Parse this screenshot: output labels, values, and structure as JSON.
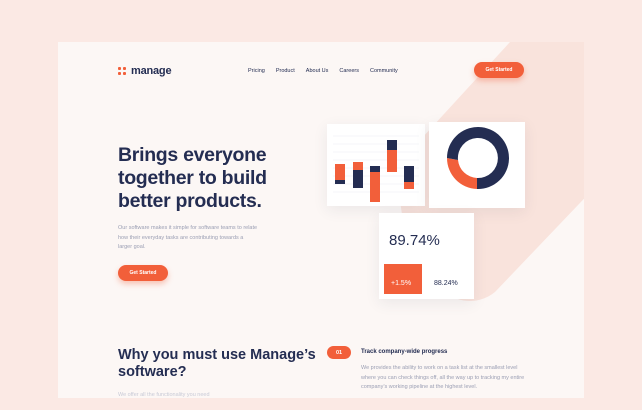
{
  "logo": {
    "text": "manage"
  },
  "nav": {
    "items": [
      "Pricing",
      "Product",
      "About Us",
      "Careers",
      "Community"
    ],
    "cta_label": "Get Started"
  },
  "hero": {
    "title": "Brings everyone together to build better products.",
    "description": "Our software makes it simple for software teams to relate how their everyday tasks are contributing towards a larger goal.",
    "cta_label": "Get Started"
  },
  "stats": {
    "main_percent": "89.74%",
    "change_percent": "+1.5%",
    "secondary_percent": "88.24%"
  },
  "section": {
    "title": "Why you must use Manage’s software?",
    "description": "We offer all the functionality you need"
  },
  "feature": {
    "number": "01",
    "title": "Track company-wide progress",
    "description": "We provides the ability to work on a task list at the smallest level where you can check things off, all the way up to tracking my entire company’s working pipeline at the highest level."
  },
  "colors": {
    "accent": "#f25f3a",
    "navy": "#242d52",
    "page_bg": "#fbe9e4",
    "panel_bg": "#fcf7f5"
  }
}
